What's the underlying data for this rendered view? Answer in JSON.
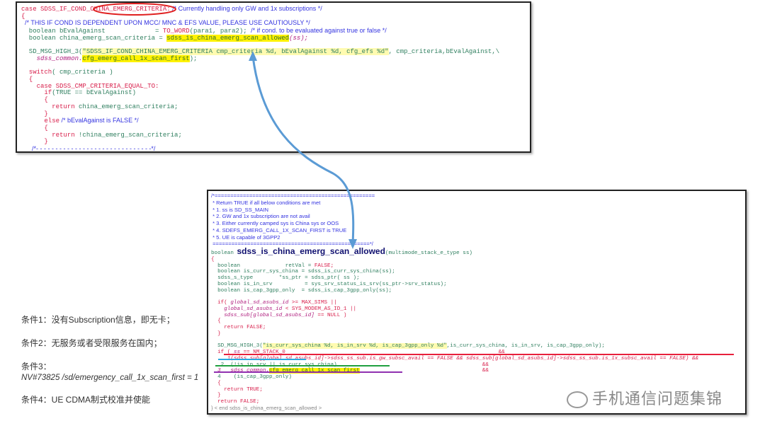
{
  "top_code": [
    [
      [
        "case SDSS_IF_COND_CHINA_EMERG_CRITERIA:",
        "k"
      ],
      [
        " /* Currently handling only GW and 1x subscriptions */",
        "c"
      ]
    ],
    [
      [
        "{",
        "k"
      ]
    ],
    [
      [
        "  /* THIS IF COND IS DEPENDENT UPON MCC/ MNC & EFS VALUE, PLEASE USE CAUTIOUSLY */",
        "c"
      ]
    ],
    [
      [
        "  boolean bEvalAgainst             = ",
        "g"
      ],
      [
        "TO_WORD",
        "k"
      ],
      [
        "(para1, para2); ",
        "g"
      ],
      [
        "/* if cond. to be evaluated against true or false */",
        "c"
      ]
    ],
    [
      [
        "  boolean china_emerg_scan_criteria = ",
        "g"
      ],
      [
        "sdss_is_china_emerg_scan_allowed",
        "h"
      ],
      [
        "(ss);",
        "i"
      ]
    ],
    [
      [
        "",
        ""
      ]
    ],
    [
      [
        "  SD_MSG_HIGH_3(",
        "g"
      ],
      [
        "\"SDSS_IF_COND_CHINA_EMERG_CRITERIA cmp_criteria %d, bEvalAgainst %d, cfg_efs %d\"",
        "s"
      ],
      [
        ", cmp_criteria,bEvalAgainst,\\",
        "g"
      ]
    ],
    [
      [
        "    sdss_common.",
        "i"
      ],
      [
        "cfg_emerg_call_1x_scan_first",
        "h"
      ],
      [
        ");",
        "g"
      ]
    ],
    [
      [
        "",
        ""
      ]
    ],
    [
      [
        "  switch",
        "k"
      ],
      [
        "( cmp_criteria )",
        "g"
      ]
    ],
    [
      [
        "  {",
        "k"
      ]
    ],
    [
      [
        "    case SDSS_CMP_CRITERIA_EQUAL_TO:",
        "k"
      ]
    ],
    [
      [
        "      if",
        "k"
      ],
      [
        "(TRUE == bEvalAgainst)",
        "g"
      ]
    ],
    [
      [
        "      {",
        "k"
      ]
    ],
    [
      [
        "        return",
        "k"
      ],
      [
        " china_emerg_scan_criteria;",
        "g"
      ]
    ],
    [
      [
        "      }",
        "k"
      ]
    ],
    [
      [
        "      else",
        "k"
      ],
      [
        " /* bEvalAgainst is FALSE */",
        "c"
      ]
    ],
    [
      [
        "      {",
        "k"
      ]
    ],
    [
      [
        "        return",
        "k"
      ],
      [
        " !china_emerg_scan_criteria;",
        "g"
      ]
    ],
    [
      [
        "      }",
        "k"
      ]
    ],
    [
      [
        "      /*- - - - - - - - - - - - - - - - - - - - - - - - - - - - - -*/",
        "c"
      ]
    ]
  ],
  "bottom_code": [
    [
      [
        "/*===================================================",
        "c"
      ]
    ],
    [
      [
        " * Return TRUE if all below conditions are met",
        "c"
      ]
    ],
    [
      [
        " * 1. ss is SD_SS_MAIN",
        "c"
      ]
    ],
    [
      [
        " * 2. GW and 1x subscription are not avail",
        "c"
      ]
    ],
    [
      [
        " * 3. Either currently camped sys is China sys or OOS",
        "c"
      ]
    ],
    [
      [
        " * 4. SDEFS_EMERG_CALL_1X_SCAN_FIRST is TRUE",
        "c"
      ]
    ],
    [
      [
        " * 5. UE is capable of 3GPP2",
        "c"
      ]
    ],
    [
      [
        " ==================================================*/",
        "c"
      ]
    ],
    [
      [
        "boolean ",
        "g"
      ],
      [
        "sdss_is_china_emerg_scan_allowed",
        "b"
      ],
      [
        "(multimode_stack_e_type ss)",
        "g"
      ]
    ],
    [
      [
        "{",
        "k"
      ]
    ],
    [
      [
        "  boolean              retVal = ",
        "g"
      ],
      [
        "FALSE;",
        "k"
      ]
    ],
    [
      [
        "  boolean is_curr_sys_china = sdss_is_curr_sys_china(ss);",
        "g"
      ]
    ],
    [
      [
        "  sdss_s_type        *ss_ptr = sdss_ptr( ss );",
        "g"
      ]
    ],
    [
      [
        "  boolean is_in_srv          = sys_srv_status_is_srv(ss_ptr->srv_status);",
        "g"
      ]
    ],
    [
      [
        "  boolean is_cap_3gpp_only  = sdss_is_cap_3gpp_only(ss);",
        "g"
      ]
    ],
    [
      [
        "",
        ""
      ]
    ],
    [
      [
        "  if( ",
        "k"
      ],
      [
        "global_sd_asubs_id",
        "i"
      ],
      [
        " >= MAX_SIMS ||",
        "k"
      ]
    ],
    [
      [
        "    global_sd_asubs_id",
        "i"
      ],
      [
        " < SYS_MODEM_AS_ID_1 ||",
        "k"
      ]
    ],
    [
      [
        "    sdss_sub[global_sd_asubs_id]",
        "i"
      ],
      [
        " == NULL )",
        "k"
      ]
    ],
    [
      [
        "  {",
        "k"
      ]
    ],
    [
      [
        "    return FALSE;",
        "k"
      ]
    ],
    [
      [
        "  }",
        "k"
      ]
    ],
    [
      [
        "",
        ""
      ]
    ],
    [
      [
        "  SD_MSG_HIGH_3(",
        "g"
      ],
      [
        "\"is_curr_sys_china %d, is_in_srv %d, is_cap_3gpp_only %d\"",
        "s"
      ],
      [
        ",is_curr_sys_china, is_in_srv, is_cap_3gpp_only);",
        "g"
      ]
    ],
    [
      [
        "  if ( ",
        "k"
      ],
      [
        "ss",
        "i"
      ],
      [
        " == NM_STACK_0                                                                  &&",
        "k"
      ]
    ],
    [
      [
        "     1(sdss_sub[global_sd_asubs_id]->sdss_ss_sub.is_gw_subsc_avail == FALSE && sdss_sub[global_sd_asubs_id]->sdss_ss_sub.is_1x_subsc_avail == FALSE) &&",
        "r"
      ]
    ],
    [
      [
        "   2  (!is_in_srv || is_curr_sys_china)",
        "g"
      ],
      [
        "                                             &&",
        "k"
      ]
    ],
    [
      [
        "  3   sdss_common.",
        "i"
      ],
      [
        "cfg_emerg_call_1x_scan_first",
        "h"
      ],
      [
        "                                      &&",
        "k"
      ]
    ],
    [
      [
        "  4    (is_cap_3gpp_only)",
        "g"
      ]
    ],
    [
      [
        "  {",
        "k"
      ]
    ],
    [
      [
        "    return TRUE;",
        "k"
      ]
    ],
    [
      [
        "  }",
        "k"
      ]
    ],
    [
      [
        "  return FALSE;",
        "k"
      ]
    ],
    [
      [
        "} < end sdss_is_china_emerg_scan_allowed >",
        "gr"
      ]
    ]
  ],
  "notes": {
    "cond1": "条件1：没有Subscription信息，即无卡；",
    "cond2": "条件2：无服务或者受限服务在国内；",
    "cond3_label": "条件3：",
    "cond3_nv": "NV#73825  /sd/emergency_call_1x_scan_first = 1",
    "cond4": "条件4：UE CDMA制式校准并使能"
  },
  "watermark": "手机通信问题集锦",
  "colors": {
    "arrow": "#5b9bd5",
    "circle": "#e02020",
    "underline1": "#e8203c",
    "underline2": "#2aa8e0",
    "underline3": "#20a040",
    "underline4": "#9030b0"
  }
}
